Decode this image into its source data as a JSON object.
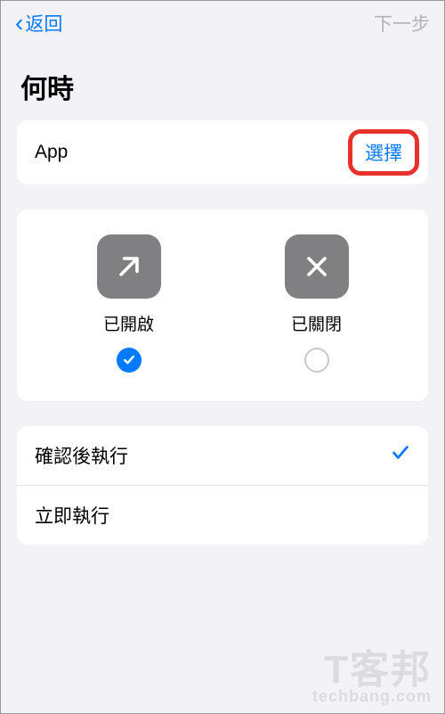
{
  "header": {
    "back_label": "返回",
    "next_label": "下一步"
  },
  "section_title": "何時",
  "app_row": {
    "label": "App",
    "select_label": "選擇"
  },
  "options": {
    "open": {
      "label": "已開啟",
      "selected": true
    },
    "close": {
      "label": "已關閉",
      "selected": false
    }
  },
  "run_list": {
    "confirm_label": "確認後執行",
    "immediate_label": "立即執行",
    "selected": "confirm"
  },
  "colors": {
    "accent": "#007aff",
    "highlight": "#e8312c",
    "icon_bg": "#808083"
  },
  "watermark": {
    "line1": "T客邦",
    "line2": "techbang.com"
  }
}
